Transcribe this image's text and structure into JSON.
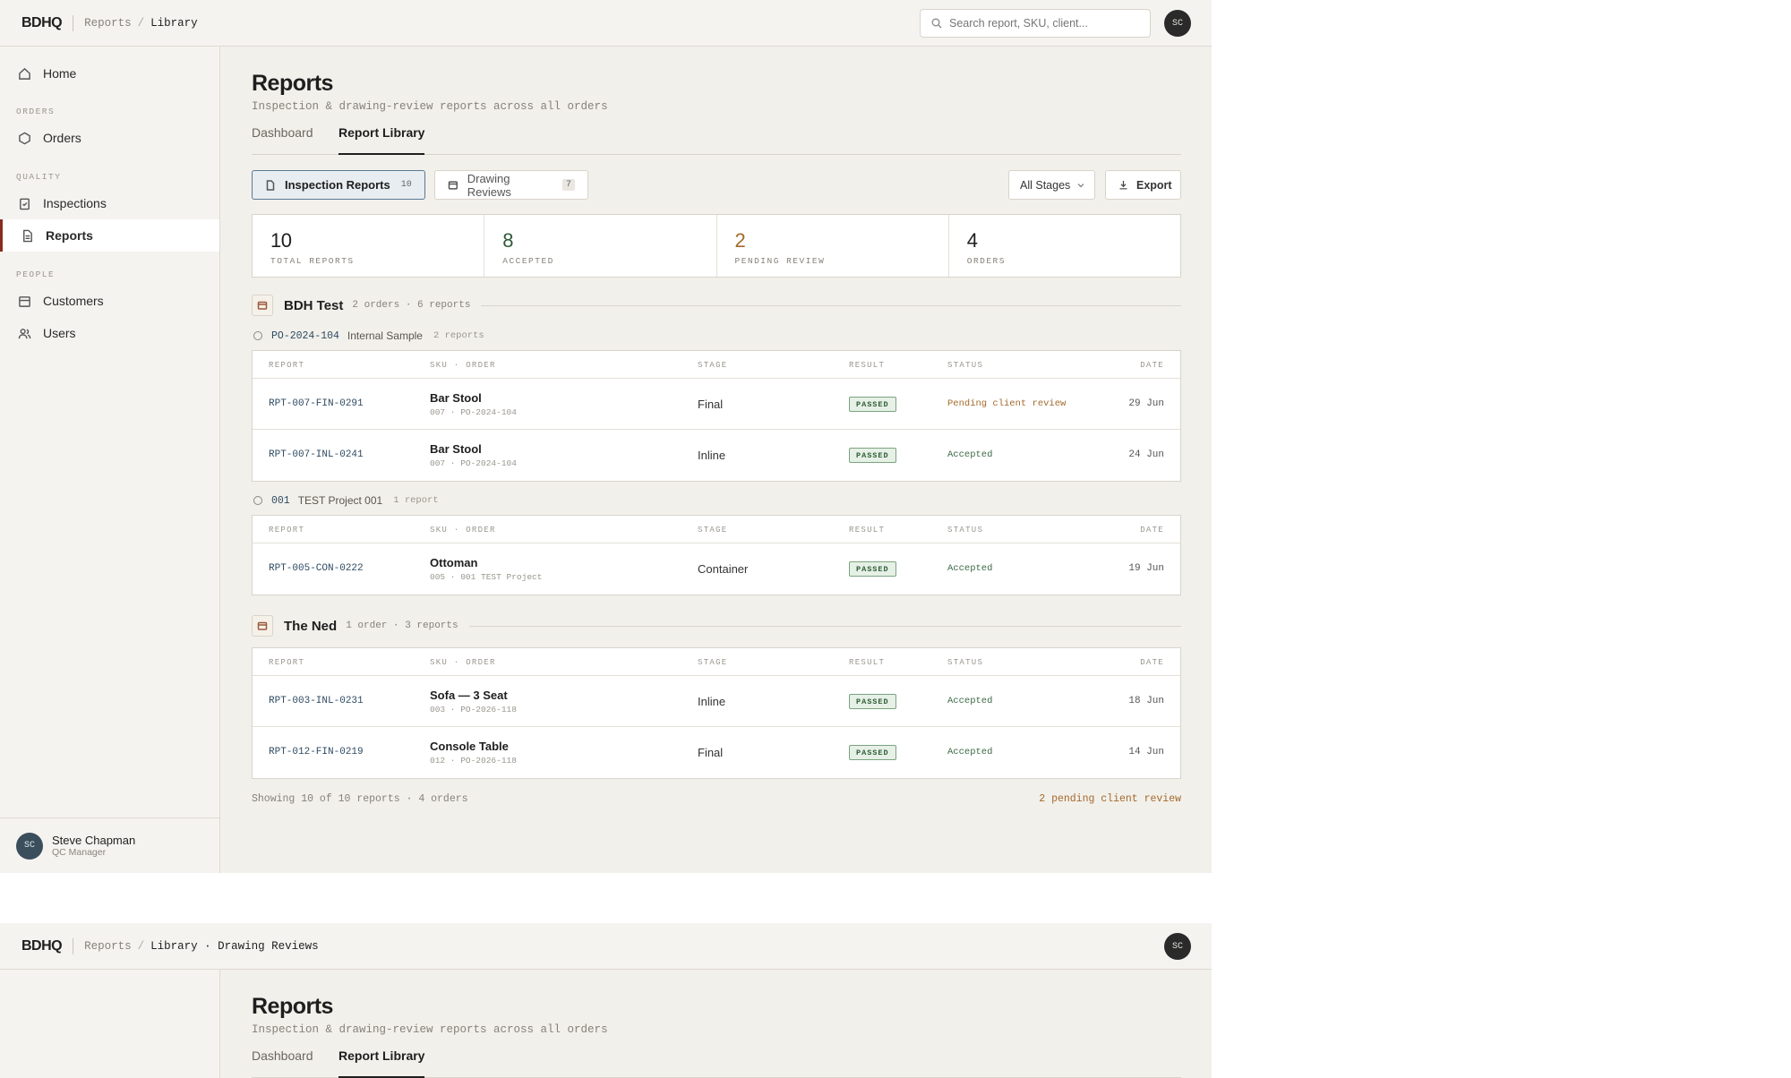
{
  "topbar": {
    "logo": "BDHQ",
    "crumb1": "Reports",
    "crumb2": "Library",
    "crumb2_alt": "Library · Drawing Reviews",
    "search_placeholder": "Search report, SKU, client...",
    "avatar": "SC"
  },
  "sidebar": {
    "home": "Home",
    "sec_orders": "ORDERS",
    "orders": "Orders",
    "sec_quality": "QUALITY",
    "inspections": "Inspections",
    "reports": "Reports",
    "sec_people": "PEOPLE",
    "customers": "Customers",
    "users": "Users",
    "user_initials": "SC",
    "user_name": "Steve Chapman",
    "user_role": "QC Manager"
  },
  "page": {
    "title": "Reports",
    "subtitle": "Inspection & drawing-review reports across all orders",
    "tab_dashboard": "Dashboard",
    "tab_library": "Report Library"
  },
  "filters": {
    "inspection_label": "Inspection Reports",
    "inspection_count": "10",
    "drawing_label": "Drawing Reviews",
    "drawing_count": "7",
    "stage_select": "All Stages",
    "export": "Export"
  },
  "stats": [
    {
      "value": "10",
      "label": "TOTAL REPORTS",
      "color": "#1e1e1e"
    },
    {
      "value": "8",
      "label": "ACCEPTED",
      "color": "#2f5a3a"
    },
    {
      "value": "2",
      "label": "PENDING REVIEW",
      "color": "#a36a2c"
    },
    {
      "value": "4",
      "label": "ORDERS",
      "color": "#1e1e1e"
    }
  ],
  "columns": {
    "report": "REPORT",
    "sku": "SKU · ORDER",
    "stage": "STAGE",
    "result": "RESULT",
    "status": "STATUS",
    "date": "DATE"
  },
  "groups": [
    {
      "name": "BDH Test",
      "meta": "2 orders · 6 reports",
      "orders": [
        {
          "id": "PO-2024-104",
          "name": "Internal Sample",
          "count": "2 reports",
          "rows": [
            {
              "report": "RPT-007-FIN-0291",
              "sku": "Bar Stool",
              "sub": "007 · PO-2024-104",
              "stage": "Final",
              "result": "PASSED",
              "status": "Pending client review",
              "date": "29 Jun"
            },
            {
              "report": "RPT-007-INL-0241",
              "sku": "Bar Stool",
              "sub": "007 · PO-2024-104",
              "stage": "Inline",
              "result": "PASSED",
              "status": "Accepted",
              "date": "24 Jun"
            }
          ]
        },
        {
          "id": "001",
          "name": "TEST Project 001",
          "count": "1 report",
          "rows": [
            {
              "report": "RPT-005-CON-0222",
              "sku": "Ottoman",
              "sub": "005 · 001 TEST Project",
              "stage": "Container",
              "result": "PASSED",
              "status": "Accepted",
              "date": "19 Jun"
            }
          ]
        }
      ]
    },
    {
      "name": "The Ned",
      "meta": "1 order · 3 reports",
      "orders": [
        {
          "rows": [
            {
              "report": "RPT-003-INL-0231",
              "sku": "Sofa — 3 Seat",
              "sub": "003 · PO-2026-118",
              "stage": "Inline",
              "result": "PASSED",
              "status": "Accepted",
              "date": "18 Jun"
            },
            {
              "report": "RPT-012-FIN-0219",
              "sku": "Console Table",
              "sub": "012 · PO-2026-118",
              "stage": "Final",
              "result": "PASSED",
              "status": "Accepted",
              "date": "14 Jun"
            }
          ]
        }
      ]
    }
  ],
  "footer": {
    "showing": "Showing 10 of 10 reports · 4 orders",
    "pending": "2 pending client review"
  }
}
